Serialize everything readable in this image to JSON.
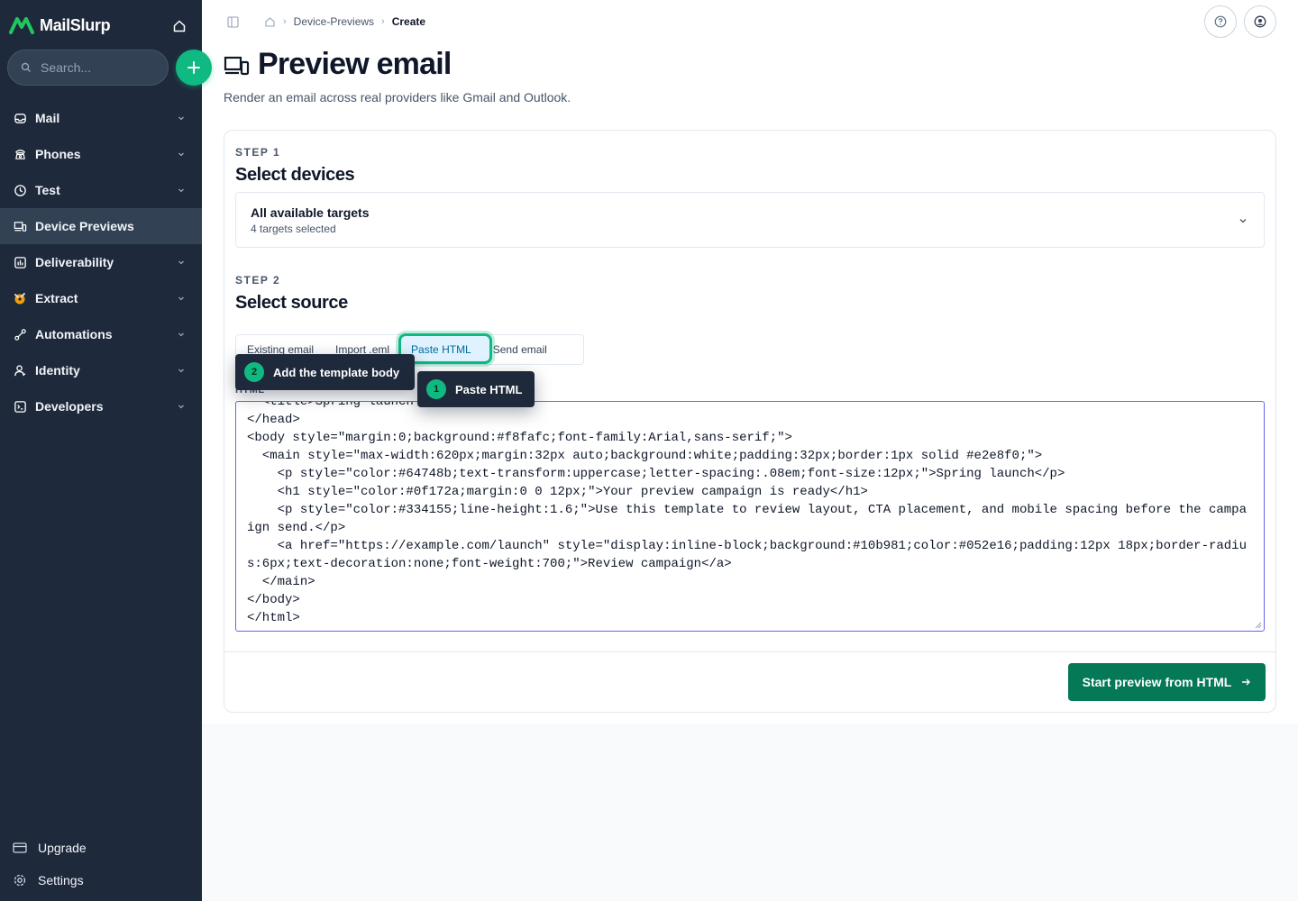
{
  "app": {
    "name": "MailSlurp"
  },
  "search": {
    "placeholder": "Search..."
  },
  "sidebar": {
    "items": [
      {
        "label": "Mail",
        "icon": "inbox-icon"
      },
      {
        "label": "Phones",
        "icon": "phone-icon"
      },
      {
        "label": "Test",
        "icon": "clock-icon"
      },
      {
        "label": "Device Previews",
        "icon": "devices-icon",
        "active": true
      },
      {
        "label": "Deliverability",
        "icon": "chart-icon"
      },
      {
        "label": "Extract",
        "icon": "extract-icon"
      },
      {
        "label": "Automations",
        "icon": "automation-icon"
      },
      {
        "label": "Identity",
        "icon": "user-icon"
      },
      {
        "label": "Developers",
        "icon": "terminal-icon"
      }
    ],
    "bottom": [
      {
        "label": "Upgrade",
        "icon": "card-icon"
      },
      {
        "label": "Settings",
        "icon": "gear-icon"
      }
    ]
  },
  "breadcrumb": {
    "section": "Device-Previews",
    "current": "Create"
  },
  "page": {
    "title": "Preview email",
    "subtitle": "Render an email across real providers like Gmail and Outlook."
  },
  "step1": {
    "label": "STEP 1",
    "title": "Select devices",
    "select_value": "All available targets",
    "select_sub": "4 targets selected"
  },
  "step2": {
    "label": "STEP 2",
    "title": "Select source",
    "tabs": [
      "Existing email",
      "Import .eml",
      "Paste HTML",
      "Send email"
    ],
    "selected_tab": "Paste HTML",
    "field_label": "HTML",
    "html_value": "  <title>Spring launch preview</title>\n</head>\n<body style=\"margin:0;background:#f8fafc;font-family:Arial,sans-serif;\">\n  <main style=\"max-width:620px;margin:32px auto;background:white;padding:32px;border:1px solid #e2e8f0;\">\n    <p style=\"color:#64748b;text-transform:uppercase;letter-spacing:.08em;font-size:12px;\">Spring launch</p>\n    <h1 style=\"color:#0f172a;margin:0 0 12px;\">Your preview campaign is ready</h1>\n    <p style=\"color:#334155;line-height:1.6;\">Use this template to review layout, CTA placement, and mobile spacing before the campaign send.</p>\n    <a href=\"https://example.com/launch\" style=\"display:inline-block;background:#10b981;color:#052e16;padding:12px 18px;border-radius:6px;text-decoration:none;font-weight:700;\">Review campaign</a>\n  </main>\n</body>\n</html>"
  },
  "actions": {
    "start_label": "Start preview from HTML"
  },
  "tooltips": [
    {
      "number": "2",
      "text": "Add the template body"
    },
    {
      "number": "1",
      "text": "Paste HTML"
    }
  ],
  "colors": {
    "sidebar": "#1e293b",
    "accent": "#10b981",
    "primary_button": "#047857",
    "focus_ring": "#6366f1"
  }
}
